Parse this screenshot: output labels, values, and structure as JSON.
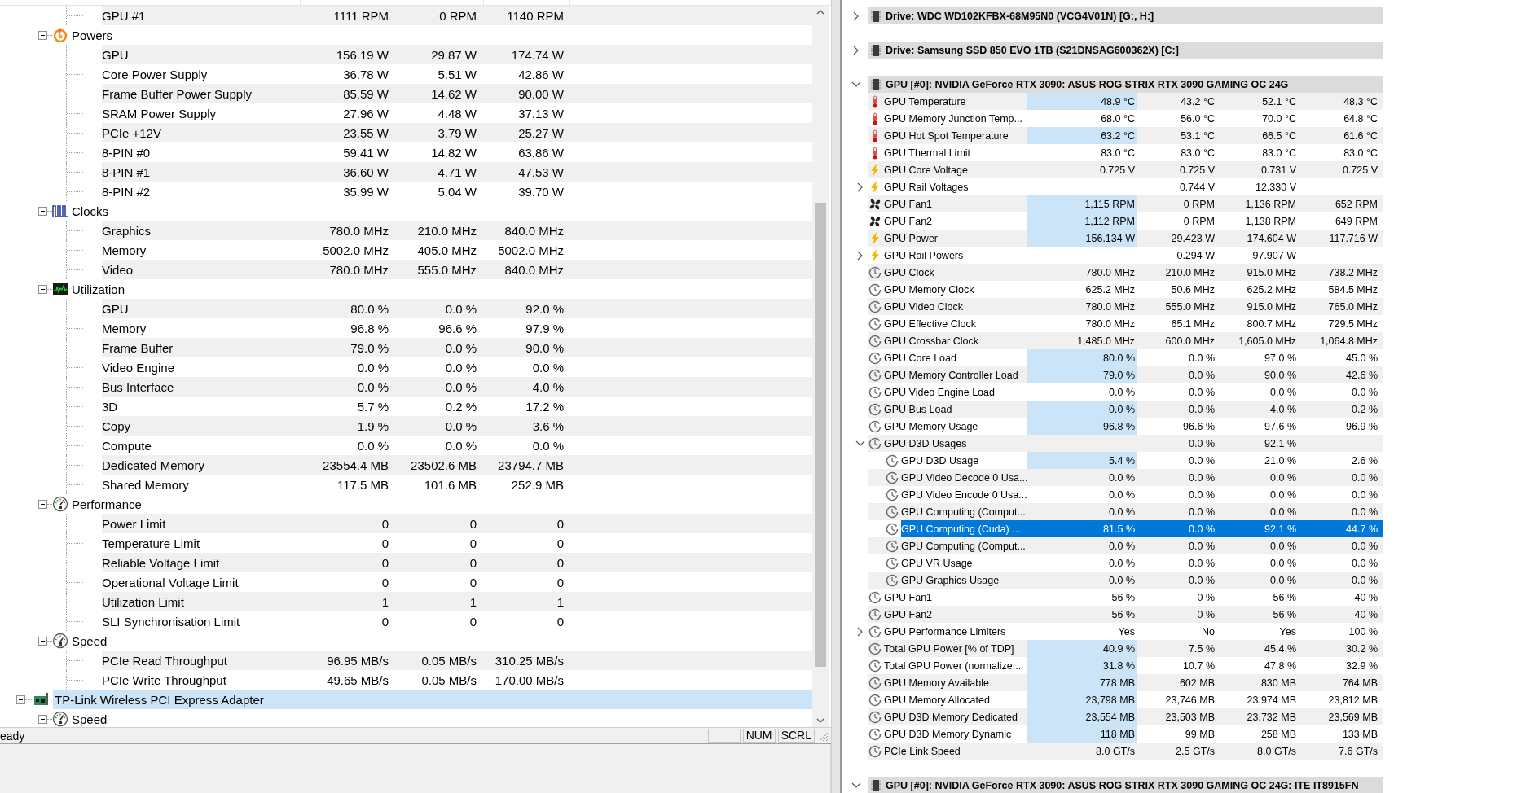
{
  "left": {
    "tree": [
      {
        "children": [
          {
            "children": [
              {
                "label": "GPU #1",
                "value": "1111 RPM",
                "min": "0 RPM",
                "max": "1140 RPM"
              }
            ]
          },
          {
            "kind": "power",
            "label": "Powers",
            "expanded": true,
            "children": [
              {
                "label": "GPU",
                "value": "156.19 W",
                "min": "29.87 W",
                "max": "174.74 W"
              },
              {
                "label": "Core Power Supply",
                "value": "36.78 W",
                "min": "5.51 W",
                "max": "42.86 W"
              },
              {
                "label": "Frame Buffer Power Supply",
                "value": "85.59 W",
                "min": "14.62 W",
                "max": "90.00 W"
              },
              {
                "label": "SRAM Power Supply",
                "value": "27.96 W",
                "min": "4.48 W",
                "max": "37.13 W"
              },
              {
                "label": "PCIe +12V",
                "value": "23.55 W",
                "min": "3.79 W",
                "max": "25.27 W"
              },
              {
                "label": "8-PIN #0",
                "value": "59.41 W",
                "min": "14.82 W",
                "max": "63.86 W"
              },
              {
                "label": "8-PIN #1",
                "value": "36.60 W",
                "min": "4.71 W",
                "max": "47.53 W"
              },
              {
                "label": "8-PIN #2",
                "value": "35.99 W",
                "min": "5.04 W",
                "max": "39.70 W"
              }
            ]
          },
          {
            "kind": "wave",
            "label": "Clocks",
            "expanded": true,
            "children": [
              {
                "label": "Graphics",
                "value": "780.0 MHz",
                "min": "210.0 MHz",
                "max": "840.0 MHz"
              },
              {
                "label": "Memory",
                "value": "5002.0 MHz",
                "min": "405.0 MHz",
                "max": "5002.0 MHz"
              },
              {
                "label": "Video",
                "value": "780.0 MHz",
                "min": "555.0 MHz",
                "max": "840.0 MHz"
              }
            ]
          },
          {
            "kind": "monitor",
            "label": "Utilization",
            "expanded": true,
            "children": [
              {
                "label": "GPU",
                "value": "80.0 %",
                "min": "0.0 %",
                "max": "92.0 %"
              },
              {
                "label": "Memory",
                "value": "96.8 %",
                "min": "96.6 %",
                "max": "97.9 %"
              },
              {
                "label": "Frame Buffer",
                "value": "79.0 %",
                "min": "0.0 %",
                "max": "90.0 %"
              },
              {
                "label": "Video Engine",
                "value": "0.0 %",
                "min": "0.0 %",
                "max": "0.0 %"
              },
              {
                "label": "Bus Interface",
                "value": "0.0 %",
                "min": "0.0 %",
                "max": "4.0 %"
              },
              {
                "label": "3D",
                "value": "5.7 %",
                "min": "0.2 %",
                "max": "17.2 %"
              },
              {
                "label": "Copy",
                "value": "1.9 %",
                "min": "0.0 %",
                "max": "3.6 %"
              },
              {
                "label": "Compute",
                "value": "0.0 %",
                "min": "0.0 %",
                "max": "0.0 %"
              },
              {
                "label": "Dedicated Memory",
                "value": "23554.4 MB",
                "min": "23502.6 MB",
                "max": "23794.7 MB"
              },
              {
                "label": "Shared Memory",
                "value": "117.5 MB",
                "min": "101.6 MB",
                "max": "252.9 MB"
              }
            ]
          },
          {
            "kind": "gauge",
            "label": "Performance",
            "expanded": true,
            "children": [
              {
                "label": "Power Limit",
                "value": "0",
                "min": "0",
                "max": "0"
              },
              {
                "label": "Temperature Limit",
                "value": "0",
                "min": "0",
                "max": "0"
              },
              {
                "label": "Reliable Voltage Limit",
                "value": "0",
                "min": "0",
                "max": "0"
              },
              {
                "label": "Operational Voltage Limit",
                "value": "0",
                "min": "0",
                "max": "0"
              },
              {
                "label": "Utilization Limit",
                "value": "1",
                "min": "1",
                "max": "1"
              },
              {
                "label": "SLI Synchronisation Limit",
                "value": "0",
                "min": "0",
                "max": "0"
              }
            ]
          },
          {
            "kind": "gauge",
            "label": "Speed",
            "expanded": true,
            "children": [
              {
                "label": "PCIe Read Throughput",
                "value": "96.95 MB/s",
                "min": "0.05 MB/s",
                "max": "310.25 MB/s"
              },
              {
                "label": "PCIe Write Throughput",
                "value": "49.65 MB/s",
                "min": "0.05 MB/s",
                "max": "170.00 MB/s"
              }
            ]
          }
        ]
      },
      {
        "kind": "netcard",
        "label": "TP-Link Wireless PCI Express Adapter",
        "selected": true,
        "expanded": true,
        "children": [
          {
            "kind": "gauge",
            "label": "Speed",
            "expanded": true
          }
        ]
      }
    ]
  },
  "status_bar": {
    "text": "eady",
    "indicators": [
      {
        "label": "NUM"
      },
      {
        "label": "SCRL"
      }
    ]
  },
  "right": {
    "items": [
      {
        "label": "Drive: WDC WD102KFBX-68M95N0 (VCG4V01N) [G:, H:]",
        "expanded": false
      },
      {
        "label": "Drive: Samsung SSD 850 EVO 1TB (S21DNSAG600362X) [C:]",
        "expanded": false
      },
      {
        "label": "GPU [#0]: NVIDIA GeForce RTX 3090: ASUS ROG STRIX RTX 3090 GAMING OC 24G",
        "expanded": true,
        "children": [
          {
            "kind": "thermometer",
            "label": "GPU Temperature",
            "value": "48.9 °C",
            "min": "43.2 °C",
            "max": "52.1 °C",
            "avg": "48.3 °C",
            "highlighted": true,
            "selected": false
          },
          {
            "kind": "thermometer",
            "label": "GPU Memory Junction Temp...",
            "value": "68.0 °C",
            "min": "56.0 °C",
            "max": "70.0 °C",
            "avg": "64.8 °C",
            "highlighted": false,
            "selected": false
          },
          {
            "kind": "thermometer",
            "label": "GPU Hot Spot Temperature",
            "value": "63.2 °C",
            "min": "53.1 °C",
            "max": "66.5 °C",
            "avg": "61.6 °C",
            "highlighted": true,
            "selected": false
          },
          {
            "kind": "thermometer",
            "label": "GPU Thermal Limit",
            "value": "83.0 °C",
            "min": "83.0 °C",
            "max": "83.0 °C",
            "avg": "83.0 °C",
            "highlighted": false,
            "selected": false
          },
          {
            "kind": "bolt",
            "label": "GPU Core Voltage",
            "value": "0.725 V",
            "min": "0.725 V",
            "max": "0.731 V",
            "avg": "0.725 V",
            "highlighted": false,
            "selected": false
          },
          {
            "kind": "bolt",
            "label": "GPU Rail Voltages",
            "min": "0.744 V",
            "max": "12.330 V",
            "selected": false,
            "expanded": false
          },
          {
            "kind": "fan",
            "label": "GPU Fan1",
            "value": "1,115 RPM",
            "min": "0 RPM",
            "max": "1,136 RPM",
            "avg": "652 RPM",
            "highlighted": true,
            "selected": false
          },
          {
            "kind": "fan",
            "label": "GPU Fan2",
            "value": "1,112 RPM",
            "min": "0 RPM",
            "max": "1,138 RPM",
            "avg": "649 RPM",
            "highlighted": true,
            "selected": false
          },
          {
            "kind": "bolt",
            "label": "GPU Power",
            "value": "156.134 W",
            "min": "29.423 W",
            "max": "174.604 W",
            "avg": "117.716 W",
            "highlighted": true,
            "selected": false
          },
          {
            "kind": "bolt",
            "label": "GPU Rail Powers",
            "min": "0.294 W",
            "max": "97.907 W",
            "selected": false,
            "expanded": false
          },
          {
            "kind": "clock",
            "label": "GPU Clock",
            "value": "780.0 MHz",
            "min": "210.0 MHz",
            "max": "915.0 MHz",
            "avg": "738.2 MHz",
            "highlighted": false,
            "selected": false
          },
          {
            "kind": "clock",
            "label": "GPU Memory Clock",
            "value": "625.2 MHz",
            "min": "50.6 MHz",
            "max": "625.2 MHz",
            "avg": "584.5 MHz",
            "highlighted": false,
            "selected": false
          },
          {
            "kind": "clock",
            "label": "GPU Video Clock",
            "value": "780.0 MHz",
            "min": "555.0 MHz",
            "max": "915.0 MHz",
            "avg": "765.0 MHz",
            "highlighted": false,
            "selected": false
          },
          {
            "kind": "clock",
            "label": "GPU Effective Clock",
            "value": "780.0 MHz",
            "min": "65.1 MHz",
            "max": "800.7 MHz",
            "avg": "729.5 MHz",
            "highlighted": false,
            "selected": false
          },
          {
            "kind": "clock",
            "label": "GPU Crossbar Clock",
            "value": "1,485.0 MHz",
            "min": "600.0 MHz",
            "max": "1,605.0 MHz",
            "avg": "1,064.8 MHz",
            "highlighted": false,
            "selected": false
          },
          {
            "kind": "clock",
            "label": "GPU Core Load",
            "value": "80.0 %",
            "min": "0.0 %",
            "max": "97.0 %",
            "avg": "45.0 %",
            "highlighted": true,
            "selected": false
          },
          {
            "kind": "clock",
            "label": "GPU Memory Controller Load",
            "value": "79.0 %",
            "min": "0.0 %",
            "max": "90.0 %",
            "avg": "42.6 %",
            "highlighted": true,
            "selected": false
          },
          {
            "kind": "clock",
            "label": "GPU Video Engine Load",
            "value": "0.0 %",
            "min": "0.0 %",
            "max": "0.0 %",
            "avg": "0.0 %",
            "highlighted": false,
            "selected": false
          },
          {
            "kind": "clock",
            "label": "GPU Bus Load",
            "value": "0.0 %",
            "min": "0.0 %",
            "max": "4.0 %",
            "avg": "0.2 %",
            "highlighted": true,
            "selected": false
          },
          {
            "kind": "clock",
            "label": "GPU Memory Usage",
            "value": "96.8 %",
            "min": "96.6 %",
            "max": "97.6 %",
            "avg": "96.9 %",
            "highlighted": true,
            "selected": false
          },
          {
            "kind": "clock",
            "label": "GPU D3D Usages",
            "min": "0.0 %",
            "max": "92.1 %",
            "selected": false,
            "expanded": true,
            "children": [
              {
                "kind": "clock",
                "label": "GPU D3D Usage",
                "value": "5.4 %",
                "min": "0.0 %",
                "max": "21.0 %",
                "avg": "2.6 %",
                "highlighted": true,
                "selected": false
              },
              {
                "kind": "clock",
                "label": "GPU Video Decode 0 Usa...",
                "value": "0.0 %",
                "min": "0.0 %",
                "max": "0.0 %",
                "avg": "0.0 %",
                "highlighted": false,
                "selected": false
              },
              {
                "kind": "clock",
                "label": "GPU Video Encode 0 Usa...",
                "value": "0.0 %",
                "min": "0.0 %",
                "max": "0.0 %",
                "avg": "0.0 %",
                "highlighted": false,
                "selected": false
              },
              {
                "kind": "clock",
                "label": "GPU Computing (Comput...",
                "value": "0.0 %",
                "min": "0.0 %",
                "max": "0.0 %",
                "avg": "0.0 %",
                "highlighted": false,
                "selected": false
              },
              {
                "kind": "clock",
                "label": "GPU Computing (Cuda) ...",
                "value": "81.5 %",
                "min": "0.0 %",
                "max": "92.1 %",
                "avg": "44.7 %",
                "highlighted": false,
                "selected": true
              },
              {
                "kind": "clock",
                "label": "GPU Computing (Comput...",
                "value": "0.0 %",
                "min": "0.0 %",
                "max": "0.0 %",
                "avg": "0.0 %",
                "highlighted": false,
                "selected": false
              },
              {
                "kind": "clock",
                "label": "GPU VR Usage",
                "value": "0.0 %",
                "min": "0.0 %",
                "max": "0.0 %",
                "avg": "0.0 %",
                "highlighted": false,
                "selected": false
              },
              {
                "kind": "clock",
                "label": "GPU Graphics Usage",
                "value": "0.0 %",
                "min": "0.0 %",
                "max": "0.0 %",
                "avg": "0.0 %",
                "highlighted": false,
                "selected": false
              }
            ]
          },
          {
            "kind": "clock",
            "label": "GPU Fan1",
            "value": "56 %",
            "min": "0 %",
            "max": "56 %",
            "avg": "40 %",
            "highlighted": false,
            "selected": false
          },
          {
            "kind": "clock",
            "label": "GPU Fan2",
            "value": "56 %",
            "min": "0 %",
            "max": "56 %",
            "avg": "40 %",
            "highlighted": false,
            "selected": false
          },
          {
            "kind": "clock",
            "label": "GPU Performance Limiters",
            "value": "Yes",
            "min": "No",
            "max": "Yes",
            "avg": "100 %",
            "highlighted": false,
            "selected": false,
            "expanded": false
          },
          {
            "kind": "clock",
            "label": "Total GPU Power [% of TDP]",
            "value": "40.9 %",
            "min": "7.5 %",
            "max": "45.4 %",
            "avg": "30.2 %",
            "highlighted": true,
            "selected": false
          },
          {
            "kind": "clock",
            "label": "Total GPU Power (normalize...",
            "value": "31.8 %",
            "min": "10.7 %",
            "max": "47.8 %",
            "avg": "32.9 %",
            "highlighted": true,
            "selected": false
          },
          {
            "kind": "clock",
            "label": "GPU Memory Available",
            "value": "778 MB",
            "min": "602 MB",
            "max": "830 MB",
            "avg": "764 MB",
            "highlighted": true,
            "selected": false
          },
          {
            "kind": "clock",
            "label": "GPU Memory Allocated",
            "value": "23,798 MB",
            "min": "23,746 MB",
            "max": "23,974 MB",
            "avg": "23,812 MB",
            "highlighted": true,
            "selected": false
          },
          {
            "kind": "clock",
            "label": "GPU D3D Memory Dedicated",
            "value": "23,554 MB",
            "min": "23,503 MB",
            "max": "23,732 MB",
            "avg": "23,569 MB",
            "highlighted": true,
            "selected": false
          },
          {
            "kind": "clock",
            "label": "GPU D3D Memory Dynamic",
            "value": "118 MB",
            "min": "99 MB",
            "max": "258 MB",
            "avg": "133 MB",
            "highlighted": true,
            "selected": false
          },
          {
            "kind": "clock",
            "label": "PCIe Link Speed",
            "value": "8.0 GT/s",
            "min": "2.5 GT/s",
            "max": "8.0 GT/s",
            "avg": "7.6 GT/s",
            "highlighted": false,
            "selected": false
          }
        ]
      },
      {
        "label": "GPU [#0]: NVIDIA GeForce RTX 3090: ASUS ROG STRIX RTX 3090 GAMING OC 24G: ITE IT8915FN",
        "expanded": true
      }
    ]
  }
}
